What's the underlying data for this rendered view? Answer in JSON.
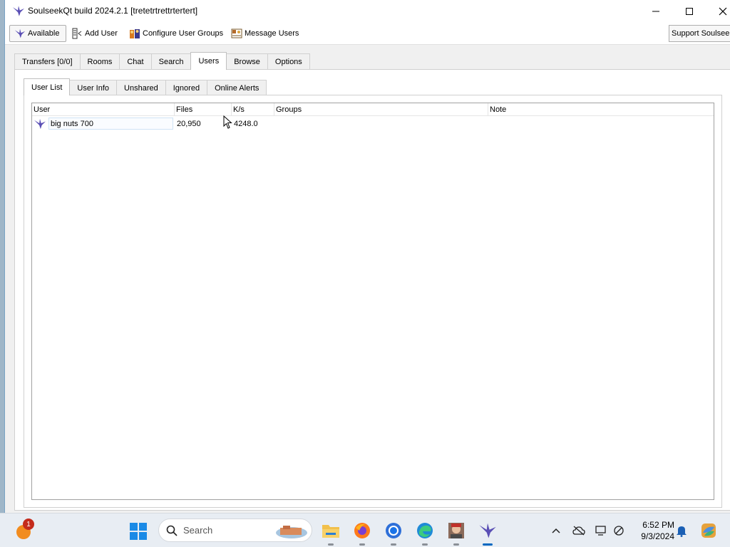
{
  "window": {
    "title": "SoulseekQt build 2024.2.1 [tretetrtrettrtertert]"
  },
  "toolbar": {
    "available": "Available",
    "add_user": "Add User",
    "configure_groups": "Configure User Groups",
    "message_users": "Message Users",
    "support": "Support Soulseek"
  },
  "main_tabs": [
    "Transfers [0/0]",
    "Rooms",
    "Chat",
    "Search",
    "Users",
    "Browse",
    "Options"
  ],
  "main_tab_active": "Users",
  "sub_tabs": [
    "User List",
    "User Info",
    "Unshared",
    "Ignored",
    "Online Alerts"
  ],
  "sub_tab_active": "User List",
  "table": {
    "columns": [
      "User",
      "Files",
      "K/s",
      "Groups",
      "Note"
    ],
    "rows": [
      {
        "user": "big nuts 700",
        "files": "20,950",
        "kbs": "4248.0",
        "groups": "",
        "note": ""
      }
    ]
  },
  "taskbar": {
    "search_placeholder": "Search",
    "weather_badge": "1",
    "time": "6:52 PM",
    "date": "9/3/2024",
    "apps": [
      "file-explorer",
      "firefox",
      "chrome",
      "edge",
      "game",
      "soulseek"
    ]
  }
}
